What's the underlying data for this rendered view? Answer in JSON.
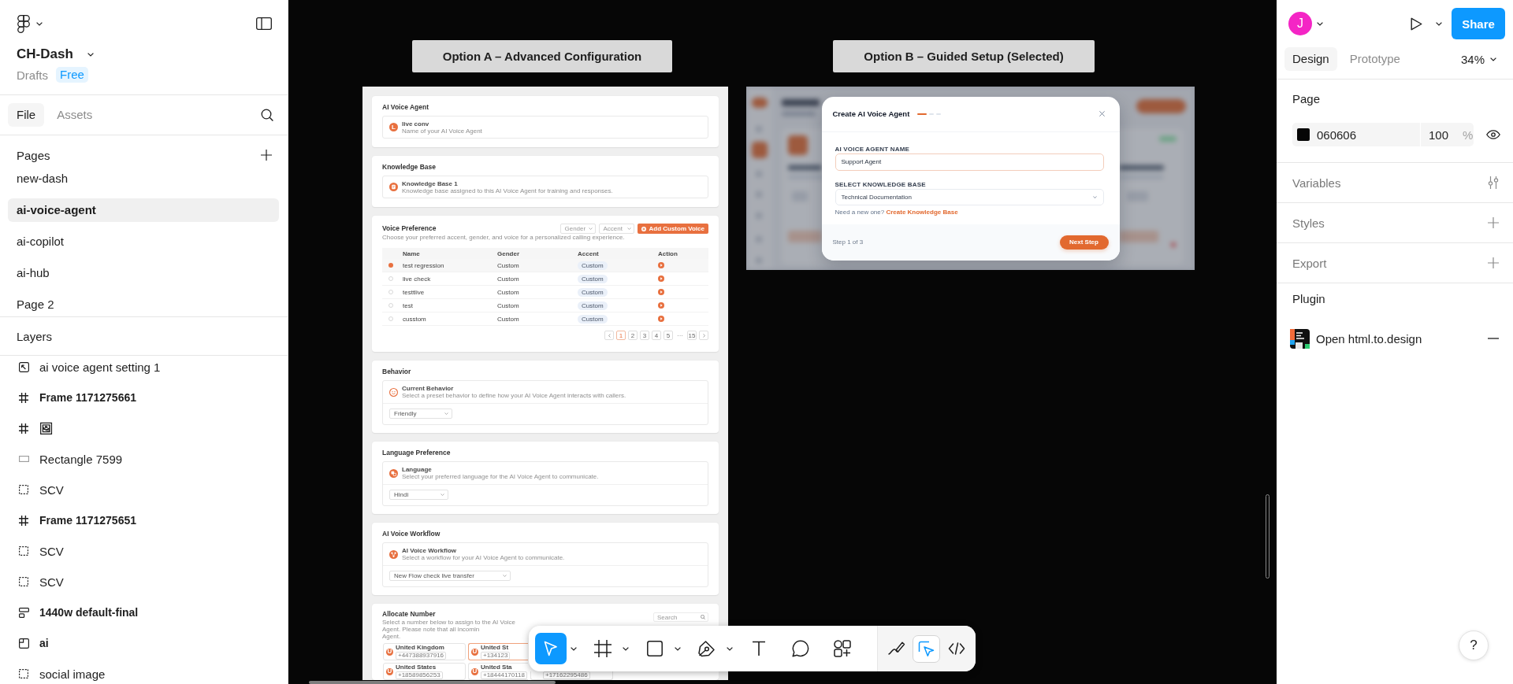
{
  "left_panel": {
    "file_name": "CH-Dash",
    "location": "Drafts",
    "plan_badge": "Free",
    "tabs": [
      {
        "label": "File",
        "selected": true
      },
      {
        "label": "Assets",
        "selected": false
      }
    ],
    "pages": {
      "title": "Pages",
      "items": [
        {
          "label": "new-dash",
          "selected": false
        },
        {
          "label": "ai-voice-agent",
          "selected": true
        },
        {
          "label": "ai-copilot",
          "selected": false
        },
        {
          "label": "ai-hub",
          "selected": false
        },
        {
          "label": "Page 2",
          "selected": false
        }
      ]
    },
    "layers": {
      "title": "Layers",
      "items": [
        {
          "kind": "image",
          "label": "ai voice agent setting 1"
        },
        {
          "kind": "frame",
          "label": "Frame 1171275661"
        },
        {
          "kind": "frame",
          "label": "🖼"
        },
        {
          "kind": "rectangle",
          "label": "Rectangle 7599"
        },
        {
          "kind": "group",
          "label": "SCV"
        },
        {
          "kind": "frame",
          "label": "Frame 1171275651"
        },
        {
          "kind": "group",
          "label": "SCV"
        },
        {
          "kind": "group",
          "label": "SCV"
        },
        {
          "kind": "auto_layout",
          "label": "1440w default-final"
        },
        {
          "kind": "section",
          "label": "ai"
        },
        {
          "kind": "group",
          "label": "social image"
        }
      ]
    }
  },
  "canvas": {
    "frame_labels": [
      "Option A – Advanced Configuration",
      "Option B – Guided Setup (Selected)"
    ],
    "option_a": {
      "sections": [
        {
          "kind": "info",
          "title": "AI Voice Agent",
          "avatar_letter": "L",
          "name": "live conv",
          "description": "Name of your AI Voice Agent"
        },
        {
          "kind": "info",
          "title": "Knowledge Base",
          "name": "Knowledge Base 1",
          "description": "Knowledge base assigned to this AI Voice Agent for training and responses."
        },
        {
          "kind": "voices",
          "title": "Voice Preference",
          "description": "Choose your preferred accent, gender, and voice for a personalized calling experience.",
          "filters": [
            {
              "placeholder": "Gender"
            },
            {
              "placeholder": "Accent"
            }
          ],
          "add_button": "Add Custom Voice",
          "columns": [
            "Name",
            "Gender",
            "Accent",
            "Action"
          ],
          "rows": [
            {
              "name": "test regression",
              "gender": "Custom",
              "accent": "Custom",
              "selected": true
            },
            {
              "name": "live check",
              "gender": "Custom",
              "accent": "Custom",
              "selected": false
            },
            {
              "name": "testtlive",
              "gender": "Custom",
              "accent": "Custom",
              "selected": false
            },
            {
              "name": "test",
              "gender": "Custom",
              "accent": "Custom",
              "selected": false
            },
            {
              "name": "cusstom",
              "gender": "Custom",
              "accent": "Custom",
              "selected": false
            }
          ],
          "pages": [
            {
              "kind": "page",
              "label": "1",
              "selected": true
            },
            {
              "kind": "page",
              "label": "2",
              "selected": false
            },
            {
              "kind": "page",
              "label": "3",
              "selected": false
            },
            {
              "kind": "page",
              "label": "4",
              "selected": false
            },
            {
              "kind": "page",
              "label": "5",
              "selected": false
            },
            {
              "kind": "ellipsis",
              "label": "···",
              "selected": false
            },
            {
              "kind": "page",
              "label": "15",
              "selected": false
            }
          ]
        },
        {
          "kind": "select",
          "title": "Behavior",
          "name": "Current Behavior",
          "description": "Select a preset behavior to define how your AI Voice Agent interacts with callers.",
          "value": "Friendly"
        },
        {
          "kind": "select",
          "title": "Language Preference",
          "name": "Language",
          "description": "Select your preferred language for the AI Voice Agent to communicate.",
          "value": "Hindi"
        },
        {
          "kind": "select",
          "title": "AI Voice Workflow",
          "name": "AI Voice Workflow",
          "description": "Select a workflow for your AI Voice Agent to communicate.",
          "value": "New Flow check live transfer"
        },
        {
          "kind": "numbers",
          "title": "Allocate Number",
          "description_lines": [
            "Select a number below to assign to the AI Voice Agent. Please note that all incomin",
            "Agent."
          ],
          "search": {
            "placeholder": "Search"
          },
          "number_rows": [
            [
              {
                "avatar_letter": "U",
                "country": "United Kingdom",
                "phone": "+447388937916",
                "selected": false
              },
              {
                "avatar_letter": "U",
                "country": "United St",
                "phone": "+134123",
                "selected": true
              }
            ],
            [
              {
                "avatar_letter": "U",
                "country": "United States",
                "phone": "+18589856253",
                "selected": false
              },
              {
                "avatar_letter": "U",
                "country": "United Sta",
                "phone": "+18444170118",
                "selected": false
              },
              {
                "phone": "+17162295486",
                "selected": false
              }
            ]
          ]
        }
      ]
    },
    "option_b": {
      "modal": {
        "title": "Create AI Voice Agent",
        "steps": [
          {
            "active": true
          },
          {
            "active": false
          },
          {
            "active": false
          }
        ],
        "fields": [
          {
            "kind": "text",
            "label": "AI VOICE AGENT NAME",
            "value": "Support Agent"
          },
          {
            "kind": "select",
            "label": "SELECT KNOWLEDGE BASE",
            "value": "Technical Documentation"
          }
        ],
        "hint": "Need a new one?",
        "link": "Create Knowledge Base",
        "progress_text": "Step 1 of 3",
        "next_button": "Next Step"
      }
    }
  },
  "toolbar": {
    "tools": [
      {
        "kind": "move",
        "selected": true,
        "menu": true
      },
      {
        "kind": "frame",
        "selected": false,
        "menu": true
      },
      {
        "kind": "rectangle",
        "selected": false,
        "menu": true
      },
      {
        "kind": "pen",
        "selected": false,
        "menu": true
      },
      {
        "kind": "text",
        "selected": false,
        "menu": false
      },
      {
        "kind": "comment",
        "selected": false,
        "menu": false
      },
      {
        "kind": "actions",
        "selected": false,
        "menu": false
      }
    ],
    "modes": [
      {
        "kind": "draw",
        "selected": false
      },
      {
        "kind": "design",
        "selected": true
      },
      {
        "kind": "dev",
        "selected": false
      }
    ]
  },
  "right_panel": {
    "avatar_letter": "J",
    "share_button": "Share",
    "tabs": [
      {
        "label": "Design",
        "selected": true
      },
      {
        "label": "Prototype",
        "selected": false
      }
    ],
    "zoom": "34%",
    "page": {
      "title": "Page",
      "color": "060606",
      "opacity": "100",
      "unit": "%"
    },
    "sections": [
      {
        "kind": "variables",
        "label": "Variables"
      },
      {
        "kind": "styles",
        "label": "Styles"
      },
      {
        "kind": "export",
        "label": "Export"
      }
    ],
    "plugin": {
      "title": "Plugin",
      "item": "Open html.to.design"
    }
  },
  "help_button": "?"
}
